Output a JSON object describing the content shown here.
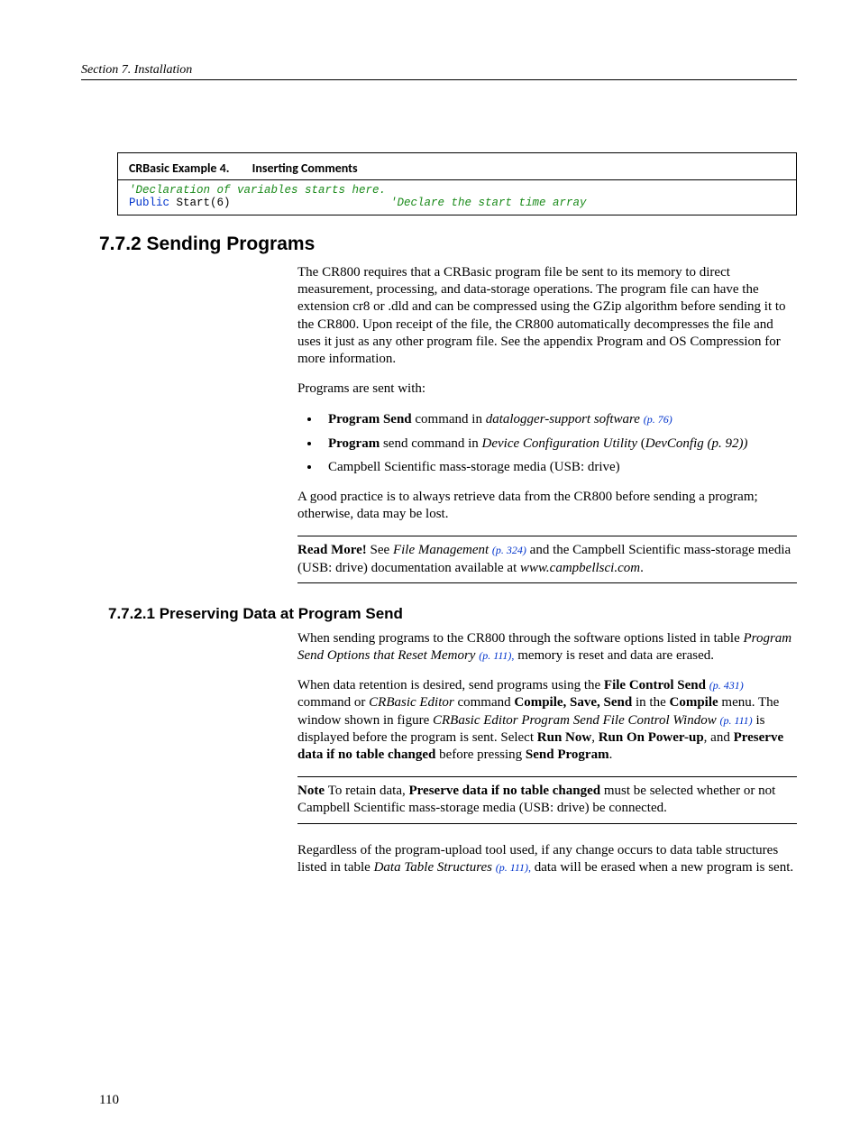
{
  "runhead": "Section 7.  Installation",
  "codebox": {
    "label": "CRBasic Example 4.",
    "name": "Inserting Comments",
    "line1_comment": "'Declaration of variables starts here.",
    "line2_keyword": "Public",
    "line2_rest": " Start(6)",
    "line2_comment": "'Declare the start time array"
  },
  "h2": "7.7.2 Sending Programs",
  "p1": "The CR800 requires that a CRBasic program file be sent to its memory to direct measurement, processing, and data-storage operations.  The program file can have the extension cr8 or .dld and can be compressed using the GZip algorithm before sending it to the CR800.  Upon receipt of the file, the CR800 automatically decompresses the file and uses it just as any other program file.  See the appendix Program and OS Compression for more information.",
  "p2": "Programs are sent with:",
  "bullets": {
    "b1": {
      "strong": "Program Send",
      "mid": " command in ",
      "ital": "datalogger-support software ",
      "pref": "(p. 76)"
    },
    "b2": {
      "strong": "Program",
      "mid": " send command in ",
      "ital1": "Device Configuration Utility",
      "paren": " (",
      "ital2": "DevConfig (p. 92))"
    },
    "b3": {
      "text": "Campbell Scientific mass-storage media (USB: drive)"
    }
  },
  "p3": "A good practice is to always retrieve data from the CR800 before sending a program; otherwise, data may be lost.",
  "note1": {
    "lead": "Read More! ",
    "t1": "See ",
    "ital": "File Management ",
    "pref": "(p. 324)",
    "t2": " and the Campbell Scientific mass-storage media (USB: drive) documentation available at ",
    "url": "www.campbellsci.com",
    "t3": "."
  },
  "h3": "7.7.2.1 Preserving Data at Program Send",
  "p4": {
    "t1": "When sending programs to the CR800 through the software options listed in table ",
    "ital": "Program Send Options that Reset Memory ",
    "pref": "(p. 111),",
    "t2": " memory is reset and data are erased."
  },
  "p5": {
    "t1": "When data retention is desired, send programs using the ",
    "b1": "File Control Send ",
    "pref1": "(p. 431)",
    "t2": " command or ",
    "i1": "CRBasic Editor",
    "t3": " command ",
    "b2": "Compile, Save, Send",
    "t4": " in the ",
    "b3": "Compile",
    "t5": " menu.  The window shown in figure ",
    "i2": "CRBasic Editor Program Send File Control Window ",
    "pref2": "(p. 111)",
    "t6": " is displayed before the program is sent. Select ",
    "b4": "Run Now",
    "t7": ", ",
    "b5": "Run On Power-up",
    "t8": ", and ",
    "b6": "Preserve data if no table changed",
    "t9": " before pressing ",
    "b7": "Send Program",
    "t10": "."
  },
  "note2": {
    "lead": "Note  ",
    "t1": "To retain data, ",
    "b": "Preserve data if no table changed",
    "t2": " must be selected whether or not Campbell Scientific mass-storage media (USB: drive) be connected."
  },
  "p6": {
    "t1": "Regardless of the program-upload tool used, if any change occurs to data table structures listed in table ",
    "ital": "Data Table Structures ",
    "pref": "(p. 111),",
    "t2": " data will be erased when a new program is sent."
  },
  "pagenum": "110"
}
